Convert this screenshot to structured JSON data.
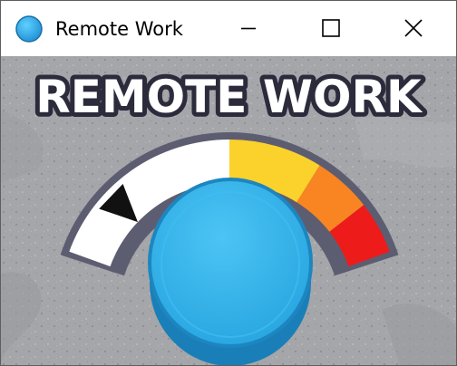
{
  "window": {
    "title": "Remote Work",
    "controls": [
      "minimize",
      "maximize",
      "close"
    ]
  },
  "game": {
    "heading": "REMOTE WORK",
    "gauge": {
      "needle_fraction": 0.17,
      "zones": [
        "white",
        "yellow",
        "orange",
        "red"
      ]
    },
    "button": {
      "shape": "round-push-button"
    }
  },
  "colors": {
    "background": "#a4a6a9",
    "gauge_frame": "#5d5d71",
    "zone_white": "#ffffff",
    "zone_yellow": "#fbd12c",
    "zone_orange": "#f98522",
    "zone_red": "#ee1b1b",
    "button_top": "#2fb2ea",
    "button_side": "#1a7fb8",
    "heading_fill": "#ffffff",
    "heading_outline": "#2b2b3c"
  }
}
